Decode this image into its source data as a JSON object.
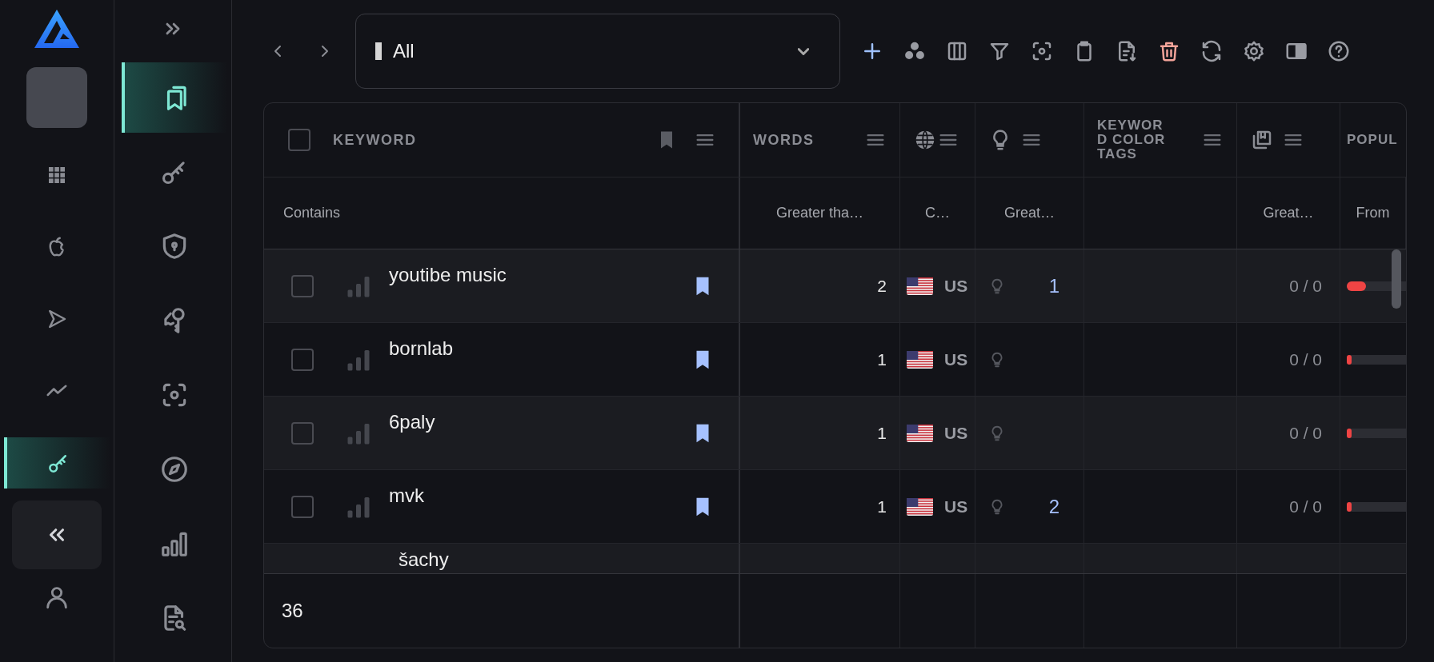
{
  "app_rail": {
    "items": [
      {
        "kind": "apps",
        "selected": false
      },
      {
        "kind": "apple",
        "selected": false
      },
      {
        "kind": "play",
        "selected": false
      },
      {
        "kind": "trend",
        "selected": false
      },
      {
        "kind": "key",
        "selected": true
      }
    ]
  },
  "section_rail": {
    "items": [
      {
        "kind": "bookmarks",
        "selected": true
      },
      {
        "kind": "key",
        "selected": false
      },
      {
        "kind": "shield",
        "selected": false
      },
      {
        "kind": "keys",
        "selected": false
      },
      {
        "kind": "scan",
        "selected": false
      },
      {
        "kind": "compass",
        "selected": false
      },
      {
        "kind": "bars",
        "selected": false
      },
      {
        "kind": "doc-search",
        "selected": false
      }
    ]
  },
  "view_select": {
    "value": "All"
  },
  "toolbar": {
    "actions": [
      {
        "kind": "add"
      },
      {
        "kind": "groups"
      },
      {
        "kind": "columns"
      },
      {
        "kind": "filter"
      },
      {
        "kind": "scan"
      },
      {
        "kind": "clipboard"
      },
      {
        "kind": "export"
      },
      {
        "kind": "delete"
      },
      {
        "kind": "refresh"
      },
      {
        "kind": "settings"
      },
      {
        "kind": "panel"
      },
      {
        "kind": "help"
      }
    ]
  },
  "table": {
    "columns": [
      {
        "kind": "keyword",
        "label": "KEYWORD",
        "filter": "Contains"
      },
      {
        "kind": "words",
        "label": "WORDS",
        "filter": "Greater tha…"
      },
      {
        "kind": "country",
        "filter": "C…"
      },
      {
        "kind": "ideas",
        "filter": "Great…"
      },
      {
        "kind": "tags",
        "label": "KEYWORD COLOR TAGS"
      },
      {
        "kind": "ratio",
        "filter": "Great…"
      },
      {
        "kind": "popularity",
        "label": "POPUL",
        "filter": "From"
      }
    ],
    "all_checked": false,
    "rows": [
      {
        "keyword": "youtibe music",
        "checked": false,
        "bookmarked": true,
        "words": "2",
        "country": "US",
        "ideas": "1",
        "ratio": "0 / 0",
        "popularity": {
          "level": 0.2
        }
      },
      {
        "keyword": "bornlab",
        "checked": false,
        "bookmarked": true,
        "words": "1",
        "country": "US",
        "ratio": "0 / 0",
        "popularity": {
          "level": 0.05
        }
      },
      {
        "keyword": "6paly",
        "checked": false,
        "bookmarked": true,
        "words": "1",
        "country": "US",
        "ratio": "0 / 0",
        "popularity": {
          "level": 0.05
        }
      },
      {
        "keyword": "mvk",
        "checked": false,
        "bookmarked": true,
        "words": "1",
        "country": "US",
        "ideas": "2",
        "ratio": "0 / 0",
        "popularity": {
          "level": 0.05
        }
      }
    ],
    "cut_row": {
      "keyword": "šachy"
    },
    "footer": {
      "count": "36"
    }
  }
}
